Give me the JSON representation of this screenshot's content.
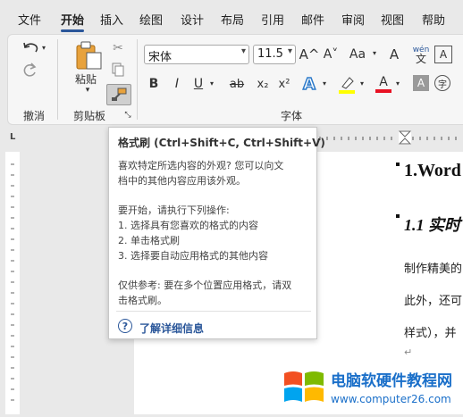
{
  "tabs": [
    "文件",
    "开始",
    "插入",
    "绘图",
    "设计",
    "布局",
    "引用",
    "邮件",
    "审阅",
    "视图",
    "帮助"
  ],
  "active_tab": "开始",
  "ribbon": {
    "undo_group_label": "撤消",
    "clipboard_group_label": "剪贴板",
    "paste_label": "粘贴",
    "font_group_label": "字体",
    "font_name": "宋体",
    "font_size": "11.5",
    "bold": "B",
    "italic": "I",
    "underline": "U",
    "strikethrough": "ab",
    "subscript": "x₂",
    "superscript": "x²",
    "grow_font": "A^",
    "shrink_font": "A˅",
    "change_case": "Aa",
    "clear_format": "A",
    "phonetic": "wén",
    "border": "A"
  },
  "tooltip": {
    "title": "格式刷 (Ctrl+Shift+C, Ctrl+Shift+V)",
    "desc_line1": "喜欢特定所选内容的外观? 您可以向文",
    "desc_line2": "档中的其他内容应用该外观。",
    "start_line": "要开始，请执行下列操作:",
    "step1": "1. 选择具有您喜欢的格式的内容",
    "step2": "2. 单击格式刷",
    "step3": "3. 选择要自动应用格式的其他内容",
    "tip_line1": "仅供参考: 要在多个位置应用格式，请双",
    "tip_line2": "击格式刷。",
    "link": "了解详细信息"
  },
  "document": {
    "heading1": "1.Word",
    "heading2": "1.1 实时",
    "para1": "制作精美的",
    "para2": "此外，还可",
    "para3": "样式），并"
  },
  "watermark": {
    "text": "电脑软硬件教程网",
    "url": "www.computer26.com"
  },
  "colors": {
    "accent": "#2b579a",
    "highlight": "#ffff00",
    "font_color": "#e81123"
  }
}
